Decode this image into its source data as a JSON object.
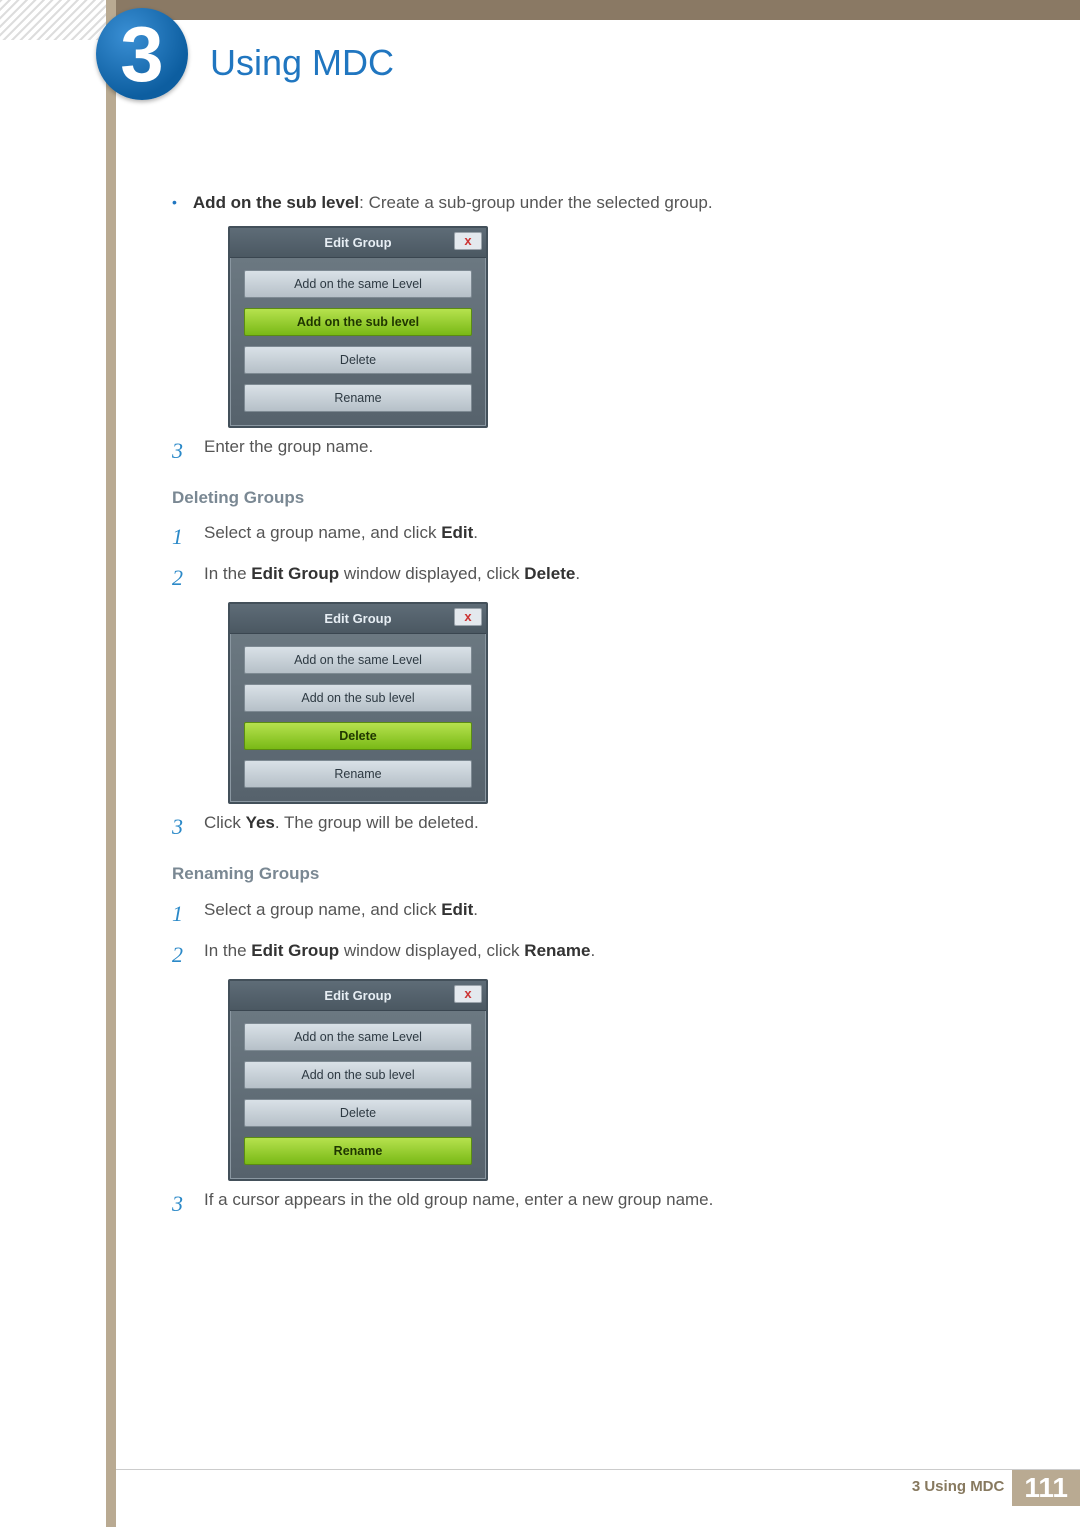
{
  "chapter": {
    "number": "3",
    "title": "Using MDC"
  },
  "footer": {
    "label": "3 Using MDC",
    "page": "111"
  },
  "intro_bullet": {
    "bold": "Add on the sub level",
    "rest": ": Create a sub-group under the selected group."
  },
  "dialog_common": {
    "title": "Edit Group",
    "close": "x",
    "buttons": [
      "Add on the same Level",
      "Add on the sub level",
      "Delete",
      "Rename"
    ]
  },
  "dialog1_active_index": 1,
  "dialog2_active_index": 2,
  "dialog3_active_index": 3,
  "step_a3": "Enter the group name.",
  "sec_del": {
    "heading": "Deleting Groups",
    "s1_a": "Select a group name, and click ",
    "s1_b": "Edit",
    "s1_c": ".",
    "s2_a": "In the ",
    "s2_b": "Edit Group",
    "s2_c": " window displayed, click ",
    "s2_d": "Delete",
    "s2_e": ".",
    "s3_a": "Click ",
    "s3_b": "Yes",
    "s3_c": ". The group will be deleted."
  },
  "sec_ren": {
    "heading": "Renaming Groups",
    "s1_a": "Select a group name, and click ",
    "s1_b": "Edit",
    "s1_c": ".",
    "s2_a": "In the ",
    "s2_b": "Edit Group",
    "s2_c": " window displayed, click ",
    "s2_d": "Rename",
    "s2_e": ".",
    "s3": "If a cursor appears in the old group name, enter a new group name."
  }
}
